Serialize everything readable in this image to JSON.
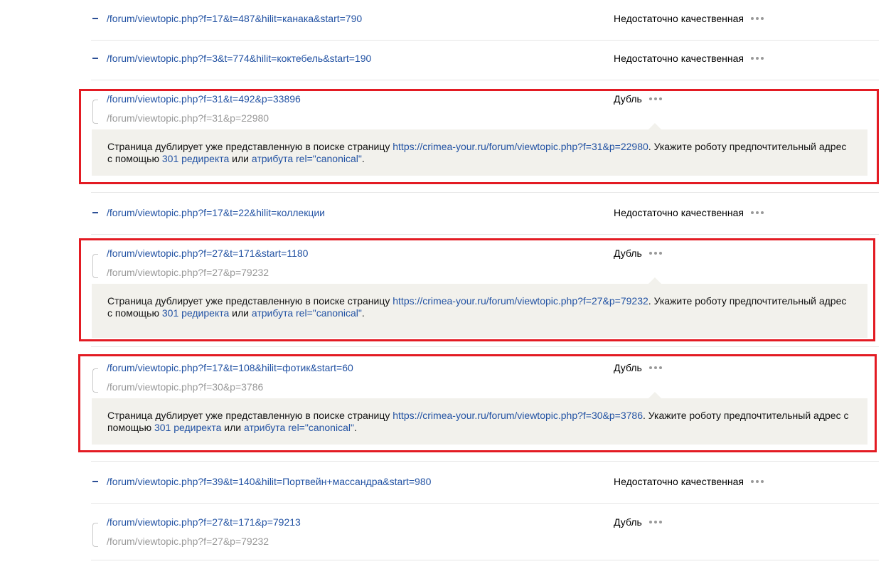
{
  "rows": [
    {
      "type": "simple",
      "url": "/forum/viewtopic.php?f=17&t=487&hilit=канака&start=790",
      "status": "Недостаточно качественная"
    },
    {
      "type": "simple",
      "url": "/forum/viewtopic.php?f=3&t=774&hilit=коктебель&start=190",
      "status": "Недостаточно качественная"
    },
    {
      "type": "duplicate",
      "url": "/forum/viewtopic.php?f=31&t=492&p=33896",
      "original_url": "/forum/viewtopic.php?f=31&p=22980",
      "status": "Дубль",
      "note": {
        "text_before": "Страница дублирует уже представленную в поиске страницу ",
        "link_url": "https://crimea-your.ru/forum/viewtopic.php?f=31&p=22980",
        "text_after": ". Укажите роботу предпочтительный адрес с помощью ",
        "redirect_link": "301 редиректа",
        "text_or": " или ",
        "canonical_link": "атрибута rel=\"canonical\"",
        "text_end": "."
      }
    },
    {
      "type": "simple",
      "url": "/forum/viewtopic.php?f=17&t=22&hilit=коллекции",
      "status": "Недостаточно качественная"
    },
    {
      "type": "duplicate",
      "url": "/forum/viewtopic.php?f=27&t=171&start=1180",
      "original_url": "/forum/viewtopic.php?f=27&p=79232",
      "status": "Дубль",
      "note": {
        "text_before": "Страница дублирует уже представленную в поиске страницу ",
        "link_url": "https://crimea-your.ru/forum/viewtopic.php?f=27&p=79232",
        "text_after": ". Укажите роботу предпочтительный адрес с помощью ",
        "redirect_link": "301 редиректа",
        "text_or": " или ",
        "canonical_link": "атрибута rel=\"canonical\"",
        "text_end": "."
      }
    },
    {
      "type": "duplicate",
      "url": "/forum/viewtopic.php?f=17&t=108&hilit=фотик&start=60",
      "original_url": "/forum/viewtopic.php?f=30&p=3786",
      "status": "Дубль",
      "note": {
        "text_before": "Страница дублирует уже представленную в поиске страницу ",
        "link_url": "https://crimea-your.ru/forum/viewtopic.php?f=30&p=3786",
        "text_after": ". Укажите роботу предпочтительный адрес с помощью ",
        "redirect_link": "301 редиректа",
        "text_or": " или ",
        "canonical_link": "атрибута rel=\"canonical\"",
        "text_end": "."
      }
    },
    {
      "type": "simple",
      "url": "/forum/viewtopic.php?f=39&t=140&hilit=Портвейн+массандра&start=980",
      "status": "Недостаточно качественная"
    },
    {
      "type": "duplicate",
      "url": "/forum/viewtopic.php?f=27&t=171&p=79213",
      "original_url": "/forum/viewtopic.php?f=27&p=79232",
      "status": "Дубль"
    }
  ],
  "colors": {
    "link": "#2252a3",
    "muted": "#999999",
    "note_bg": "#f2f1ec",
    "highlight": "#e31b23"
  },
  "icons": {
    "collapse": "minus-icon",
    "group": "bracket-icon",
    "menu": "more-dots-icon"
  }
}
